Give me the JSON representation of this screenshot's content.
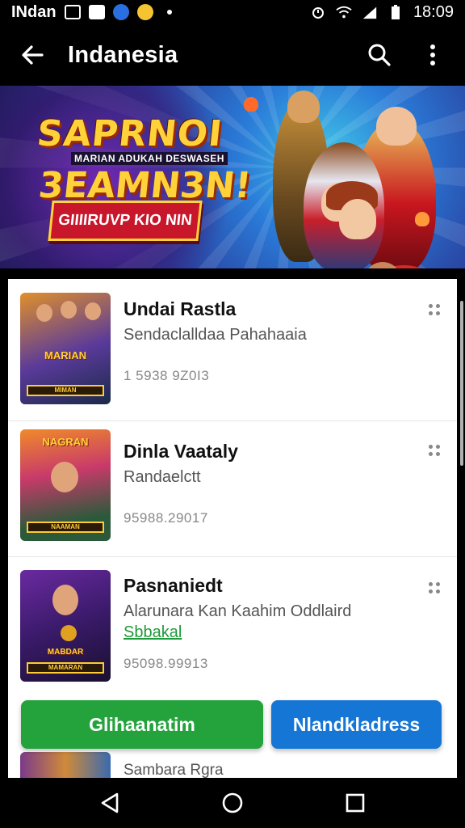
{
  "status_bar": {
    "carrier": "INdan",
    "time": "18:09",
    "icons": [
      "image-icon",
      "photo-icon",
      "shield-icon",
      "emoji-icon",
      "dot-icon",
      "alarm-icon",
      "wifi-icon",
      "signal-icon",
      "battery-icon"
    ]
  },
  "app_bar": {
    "title": "Indanesia",
    "back_icon": "arrow-left-icon",
    "actions": [
      "search-icon",
      "more-vert-icon"
    ]
  },
  "banner": {
    "title": "SAPRNOI",
    "subtitle": "MARIAN ADUKAH DESWASEH",
    "big_text": "3EAMN3N!",
    "ribbon_text": "GIIIIRUVP KIO NIN",
    "colors": {
      "accent": "#ffd23a",
      "ribbon": "#c8162a",
      "background": "#2a3c9a"
    }
  },
  "items": [
    {
      "name": "Undai Rastla",
      "subtitle": "Sendaclalldaa Pahahaaia",
      "number": "1 5938 9Z0I3",
      "thumb_label": "MARIAN",
      "thumb_caption": "MIMAN"
    },
    {
      "name": "Dinla Vaataly",
      "subtitle": "Randaelctt",
      "number": "95988.29017",
      "thumb_label": "NAGRAN",
      "thumb_caption": "NAAMAN"
    },
    {
      "name": "Pasnaniedt",
      "subtitle": "Alarunara Kan Kaahim Oddlaird",
      "tag": "Sbbakal",
      "number": "95098.99913",
      "thumb_label": "MABDAR",
      "thumb_caption": "MAMARAN"
    }
  ],
  "partial_item": {
    "name": "Sambara Rgra"
  },
  "buttons": {
    "primary_label": "Glihaanatim",
    "secondary_label": "Nlandkladress",
    "primary_color": "#24a23c",
    "secondary_color": "#1676d6"
  },
  "nav_bar": {
    "icons": [
      "back-triangle-icon",
      "home-circle-icon",
      "recents-square-icon"
    ]
  }
}
